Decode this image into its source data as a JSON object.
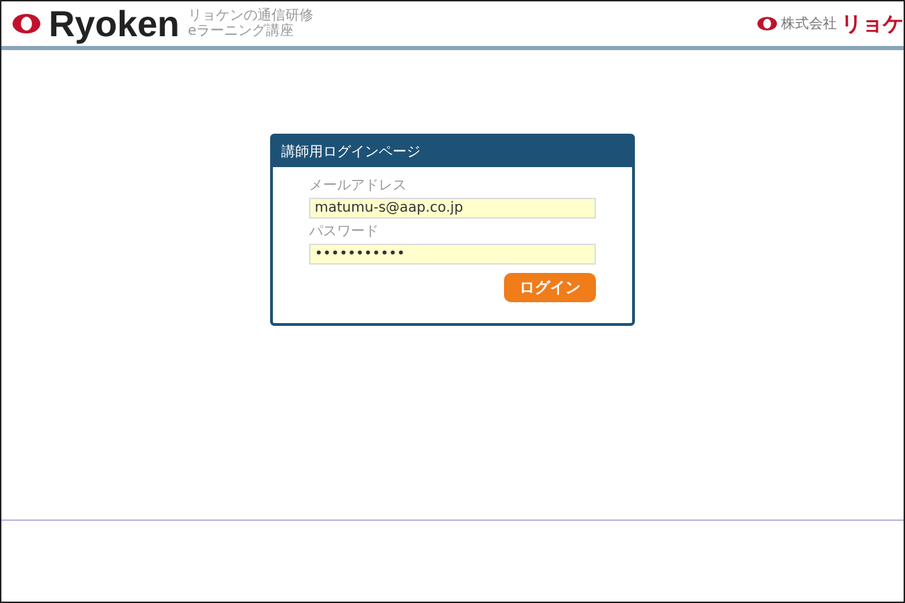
{
  "header": {
    "logo": "Ryoken",
    "tagline": [
      "リョケンの通信研修",
      "eラーニング講座"
    ],
    "company_prefix": "株式会社",
    "company": "リョケ"
  },
  "login": {
    "title": "講師用ログインページ",
    "fields": [
      {
        "label": "メールアドレス",
        "value": "matumu-s@aap.co.jp"
      },
      {
        "label": "パスワード",
        "value": "•••••••••••"
      }
    ],
    "button": "ログイン"
  }
}
